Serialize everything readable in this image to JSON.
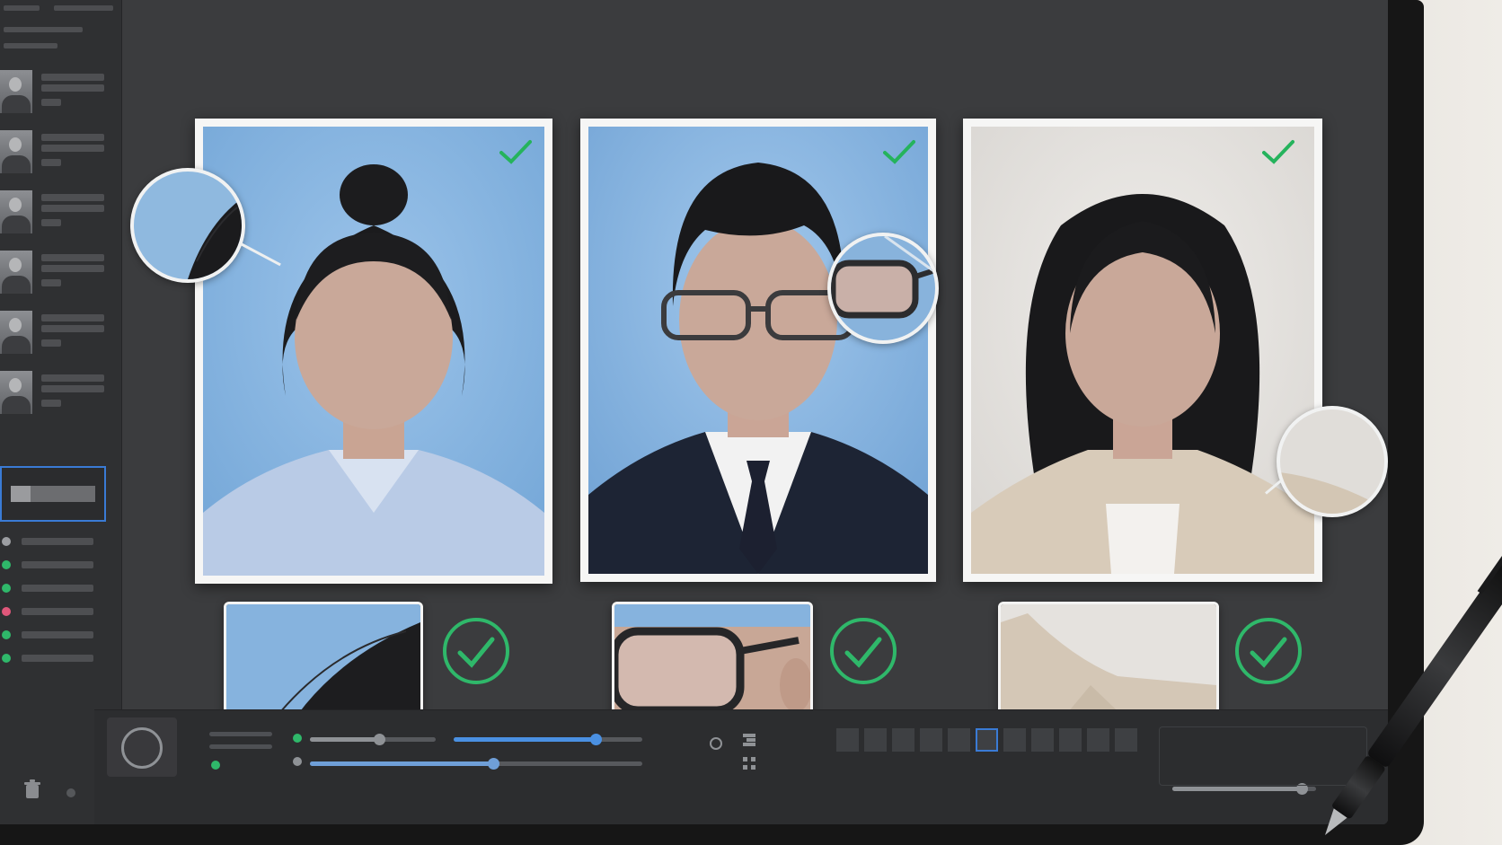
{
  "app": {
    "theme": "dark photo-review workspace",
    "accent_color": "#3a7bd5",
    "ok_color": "#2fb86a",
    "alert_color": "#e0577a"
  },
  "sidebar": {
    "thumbnails": [
      {
        "icon": "portrait-thumbnail"
      },
      {
        "icon": "portrait-thumbnail"
      },
      {
        "icon": "portrait-thumbnail"
      },
      {
        "icon": "portrait-thumbnail"
      },
      {
        "icon": "portrait-thumbnail"
      },
      {
        "icon": "portrait-thumbnail"
      }
    ],
    "status_dots": [
      "#9c9ea2",
      "#2fb86a",
      "#2fb86a",
      "#e0577a",
      "#2fb86a",
      "#2fb86a"
    ]
  },
  "photos": [
    {
      "background": "#86b6e0",
      "status": "approved",
      "check_icon": "checkmark-icon",
      "zoom_subject": "hair-edge"
    },
    {
      "background": "#86b6e0",
      "status": "approved",
      "check_icon": "checkmark-icon",
      "zoom_subject": "glasses-frame"
    },
    {
      "background": "#e4e2df",
      "status": "approved",
      "check_icon": "checkmark-icon",
      "zoom_subject": "jacket-edge"
    }
  ],
  "details": [
    {
      "subject": "hair-edge",
      "status": "approved",
      "icon": "circle-check-icon"
    },
    {
      "subject": "glasses-frame",
      "status": "approved",
      "icon": "circle-check-icon"
    },
    {
      "subject": "jacket-edge",
      "status": "approved",
      "icon": "circle-check-icon"
    }
  ],
  "toolbar": {
    "sliders": [
      {
        "name": "slider-1",
        "level": 0.55,
        "color": "#8f9296"
      },
      {
        "name": "slider-2",
        "level": 0.75,
        "color": "#4a90e2"
      },
      {
        "name": "slider-3",
        "level": 0.55,
        "color": "#6f9fd8"
      },
      {
        "name": "slider-4",
        "level": 0.9,
        "color": "#8f9296"
      }
    ],
    "filmstrip_count": 11,
    "filmstrip_selected": 5
  }
}
